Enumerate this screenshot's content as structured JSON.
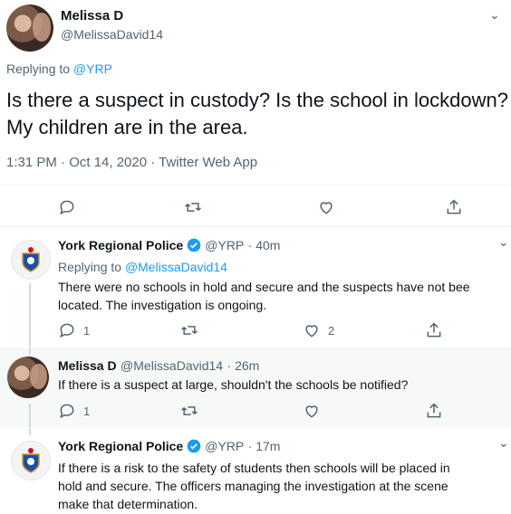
{
  "main_tweet": {
    "author_name": "Melissa D",
    "author_handle": "@MelissaDavid14",
    "replying_to_label": "Replying to",
    "replying_to_handle": "@YRP",
    "text_line1": "Is there a suspect in custody? Is the school in lockdown?",
    "text_line2": "My children are in the area.",
    "timestamp": "1:31 PM · Oct 14, 2020 · Twitter Web App",
    "icons": [
      "reply-icon",
      "retweet-icon",
      "like-icon",
      "share-icon"
    ]
  },
  "replies": [
    {
      "author_name": "York Regional Police",
      "author_handle": "@YRP",
      "time": "· 40m",
      "replying_to_label": "Replying to",
      "replying_to_handle": "@MelissaDavid14",
      "text_line1": "There were no schools in hold and secure and the suspects have not bee",
      "text_line2": "located. The investigation is ongoing.",
      "reply_count": "1",
      "like_count": "2"
    },
    {
      "author_name": "Melissa D",
      "author_handle": "@MelissaDavid14",
      "time": "· 26m",
      "text_line1": "If there is a suspect at large, shouldn't the schools be notified?",
      "reply_count": "1"
    },
    {
      "author_name": "York Regional Police",
      "author_handle": "@YRP",
      "time": "· 17m",
      "text_line1": "If there is a risk to the safety of students then schools will be placed in",
      "text_line2": "hold and secure. The officers managing the investigation at the scene",
      "text_line3": "make that determination."
    }
  ],
  "colors": {
    "accent_blue": "#1d9bf0",
    "muted_gray": "#536471",
    "highlight_bg": "#f7f9f9"
  }
}
